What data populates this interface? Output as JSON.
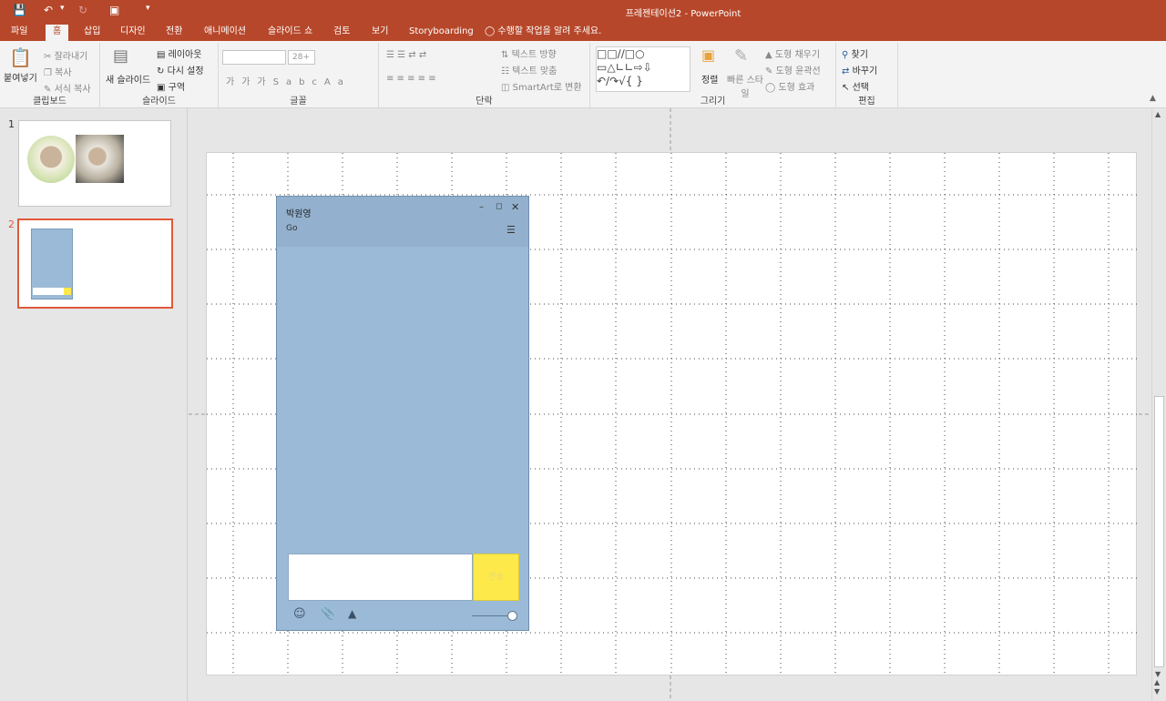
{
  "window": {
    "title": "프레젠테이션2 - PowerPoint",
    "tell_me": "수행할 작업을 알려 주세요."
  },
  "tabs": [
    "파일",
    "홈",
    "삽입",
    "디자인",
    "전환",
    "애니메이션",
    "슬라이드 쇼",
    "검토",
    "보기",
    "Storyboarding"
  ],
  "ribbon": {
    "clipboard": {
      "label": "클립보드",
      "paste": "붙여넣기",
      "cut": "잘라내기",
      "copy": "복사",
      "format_painter": "서식 복사"
    },
    "slides": {
      "label": "슬라이드",
      "new_slide": "새 슬라이드",
      "layout": "레이아웃",
      "reset": "다시 설정",
      "section": "구역"
    },
    "font": {
      "label": "글꼴",
      "size": "28+"
    },
    "paragraph": {
      "label": "단락",
      "text_direction": "텍스트 방향",
      "align_text": "텍스트 맞춤",
      "smartart": "SmartArt로 변환"
    },
    "drawing": {
      "label": "그리기",
      "arrange": "정렬",
      "quick_styles": "빠른 스타일",
      "shape_fill": "도형 채우기",
      "shape_outline": "도형 윤곽선",
      "shape_effects": "도형 효과"
    },
    "editing": {
      "label": "편집",
      "find": "찾기",
      "replace": "바꾸기",
      "select": "선택"
    }
  },
  "slides_pane": {
    "numbers": [
      "1",
      "2"
    ],
    "selected": 2
  },
  "slide": {
    "chat_window": {
      "name": "박원영",
      "status": "Go",
      "send_label": "전송"
    }
  },
  "colors": {
    "accent": "#b7472a",
    "chat_bg": "#9bbad7",
    "send_button": "#fde94a"
  }
}
